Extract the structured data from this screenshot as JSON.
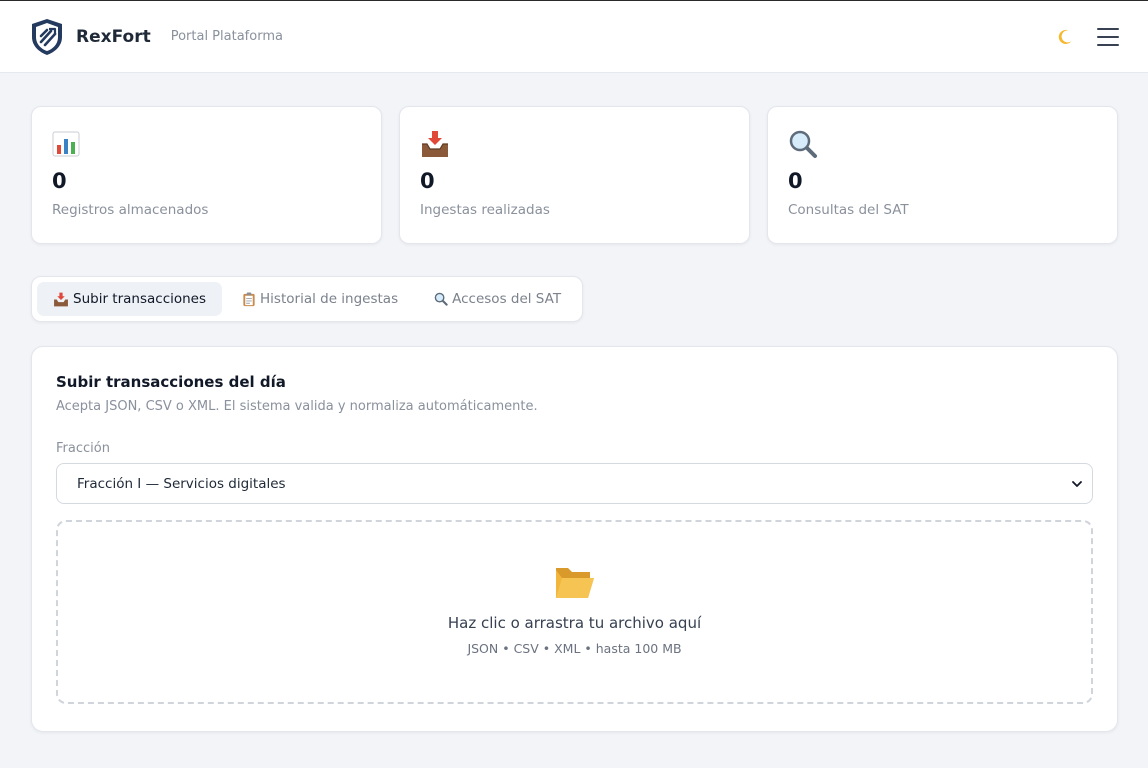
{
  "header": {
    "brand": "RexFort",
    "subtitle": "Portal Plataforma",
    "icons": {
      "logo": "shield-logo-icon",
      "theme": "moon-icon",
      "menu": "hamburger-menu-icon"
    }
  },
  "stats": [
    {
      "icon": "bar-chart-icon",
      "value": "0",
      "label": "Registros almacenados"
    },
    {
      "icon": "inbox-tray-icon",
      "value": "0",
      "label": "Ingestas realizadas"
    },
    {
      "icon": "magnifier-icon",
      "value": "0",
      "label": "Consultas del SAT"
    }
  ],
  "tabs": [
    {
      "icon": "inbox-tray-icon",
      "label": "Subir transacciones",
      "active": true
    },
    {
      "icon": "clipboard-icon",
      "label": "Historial de ingestas",
      "active": false
    },
    {
      "icon": "magnifier-icon",
      "label": "Accesos del SAT",
      "active": false
    }
  ],
  "upload": {
    "title": "Subir transacciones del día",
    "description": "Acepta JSON, CSV o XML. El sistema valida y normaliza automáticamente.",
    "fraccion_label": "Fracción",
    "fraccion_selected": "Fracción I — Servicios digitales",
    "dropzone_icon": "open-folder-icon",
    "dropzone_title": "Haz clic o arrastra tu archivo aquí",
    "dropzone_subtitle": "JSON • CSV • XML • hasta 100 MB"
  },
  "colors": {
    "accent_orange": "#e0483a",
    "moon": "#f5b82e",
    "folder": "#f2b63c",
    "logo_dark": "#243a5e"
  }
}
